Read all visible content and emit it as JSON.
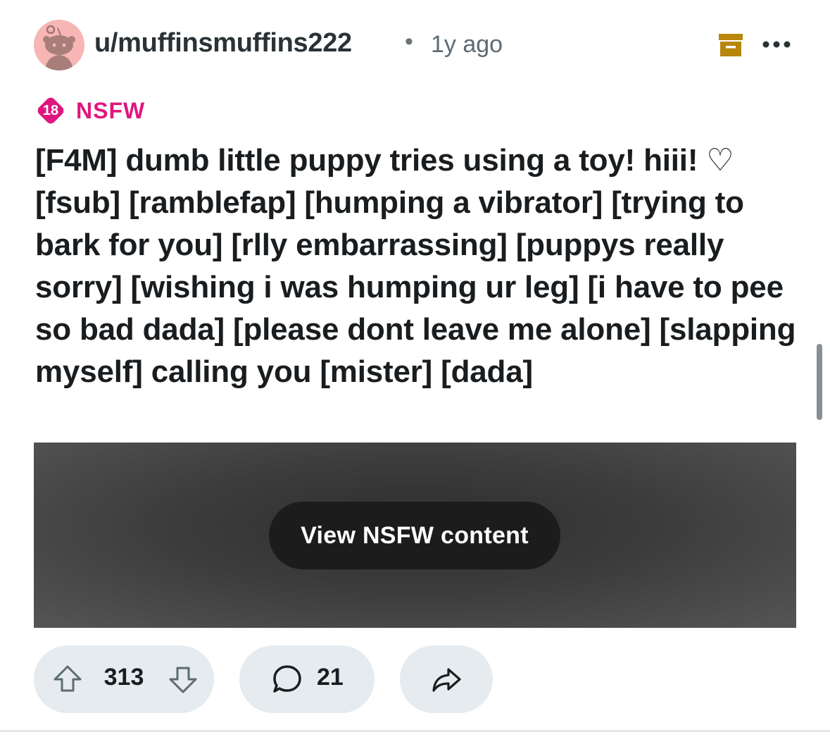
{
  "post": {
    "username": "u/muffinsmuffins222",
    "separator": "•",
    "time_ago": "1y ago",
    "nsfw_badge_number": "18",
    "nsfw_label": "NSFW",
    "title": "[F4M] dumb little puppy tries using a toy! hiii! ♡ [fsub] [ramblefap] [humping a vibrator] [trying to bark for you] [rlly embarrassing] [puppys really sorry] [wishing i was humping ur leg] [i have to pee so bad dada] [please dont leave me alone] [slapping myself] calling you [mister] [dada]",
    "media": {
      "view_button_label": "View NSFW content"
    },
    "actions": {
      "vote_count": "313",
      "comment_count": "21"
    }
  },
  "icons": {
    "archive": "archive-icon",
    "more": "more-options-icon",
    "upvote": "upvote-arrow-icon",
    "downvote": "downvote-arrow-icon",
    "comment": "comment-bubble-icon",
    "share": "share-arrow-icon"
  },
  "colors": {
    "nsfw_pink": "#e0167f",
    "archive_gold": "#b8860b",
    "avatar_bg": "#f7b6b4",
    "pill_bg": "#e5ebee",
    "text_dark": "#1a1d1f"
  }
}
